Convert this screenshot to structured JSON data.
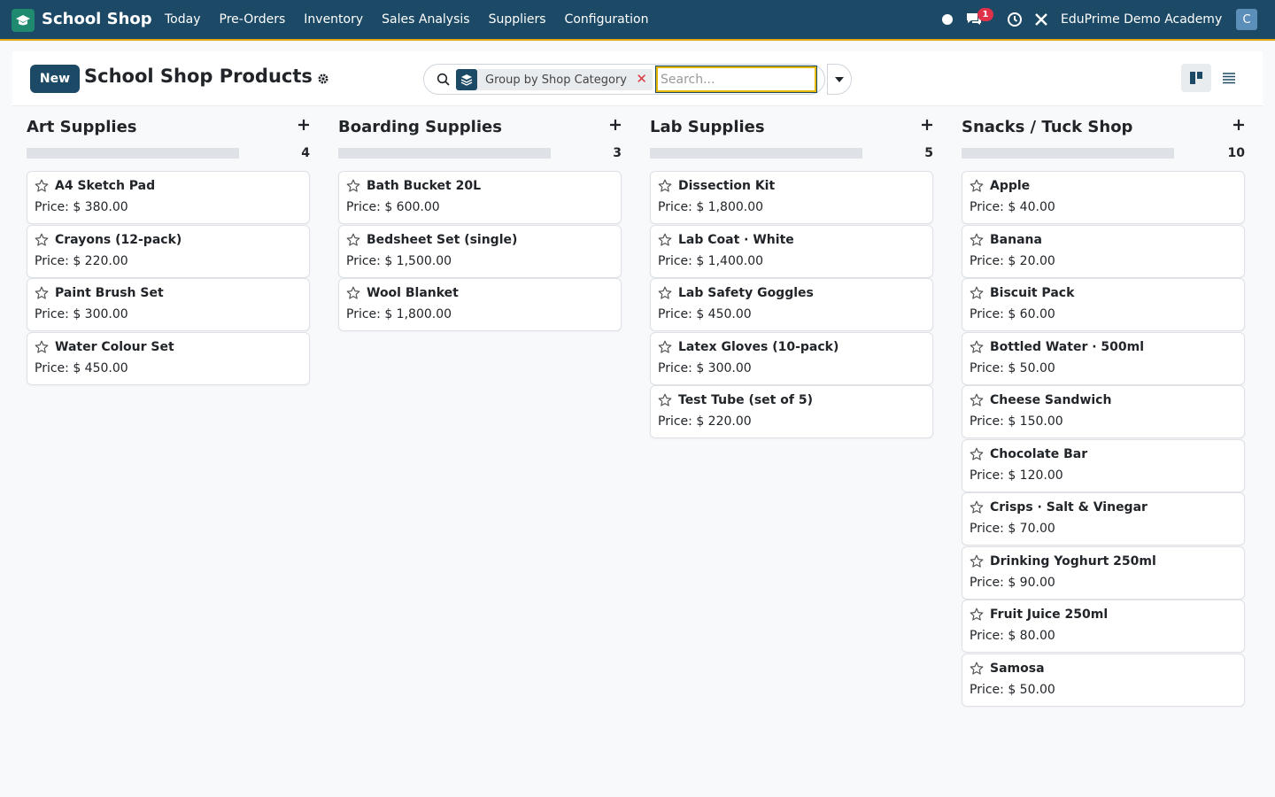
{
  "app": {
    "name": "School Shop",
    "menu": [
      "Today",
      "Pre-Orders",
      "Inventory",
      "Sales Analysis",
      "Suppliers",
      "Configuration"
    ],
    "chat_badge": "1",
    "company": "EduPrime Demo Academy",
    "avatar_letter": "C"
  },
  "control": {
    "new_label": "New",
    "title": "School Shop Products",
    "facet_label": "Group by Shop Category",
    "search_placeholder": "Search..."
  },
  "price_label": "Price:",
  "columns": [
    {
      "title": "Art Supplies",
      "count": "4",
      "cards": [
        {
          "name": "A4 Sketch Pad",
          "price": "$ 380.00"
        },
        {
          "name": "Crayons (12-pack)",
          "price": "$ 220.00"
        },
        {
          "name": "Paint Brush Set",
          "price": "$ 300.00"
        },
        {
          "name": "Water Colour Set",
          "price": "$ 450.00"
        }
      ]
    },
    {
      "title": "Boarding Supplies",
      "count": "3",
      "cards": [
        {
          "name": "Bath Bucket 20L",
          "price": "$ 600.00"
        },
        {
          "name": "Bedsheet Set (single)",
          "price": "$ 1,500.00"
        },
        {
          "name": "Wool Blanket",
          "price": "$ 1,800.00"
        }
      ]
    },
    {
      "title": "Lab Supplies",
      "count": "5",
      "cards": [
        {
          "name": "Dissection Kit",
          "price": "$ 1,800.00"
        },
        {
          "name": "Lab Coat · White",
          "price": "$ 1,400.00"
        },
        {
          "name": "Lab Safety Goggles",
          "price": "$ 450.00"
        },
        {
          "name": "Latex Gloves (10-pack)",
          "price": "$ 300.00"
        },
        {
          "name": "Test Tube (set of 5)",
          "price": "$ 220.00"
        }
      ]
    },
    {
      "title": "Snacks / Tuck Shop",
      "count": "10",
      "cards": [
        {
          "name": "Apple",
          "price": "$ 40.00"
        },
        {
          "name": "Banana",
          "price": "$ 20.00"
        },
        {
          "name": "Biscuit Pack",
          "price": "$ 60.00"
        },
        {
          "name": "Bottled Water · 500ml",
          "price": "$ 50.00"
        },
        {
          "name": "Cheese Sandwich",
          "price": "$ 150.00"
        },
        {
          "name": "Chocolate Bar",
          "price": "$ 120.00"
        },
        {
          "name": "Crisps · Salt & Vinegar",
          "price": "$ 70.00"
        },
        {
          "name": "Drinking Yoghurt 250ml",
          "price": "$ 90.00"
        },
        {
          "name": "Fruit Juice 250ml",
          "price": "$ 80.00"
        },
        {
          "name": "Samosa",
          "price": "$ 50.00"
        }
      ]
    }
  ],
  "colors": {
    "navbar": "#1c4a66",
    "accent": "#e6a817",
    "app_icon": "#1f8a70",
    "badge": "#e0314b"
  }
}
